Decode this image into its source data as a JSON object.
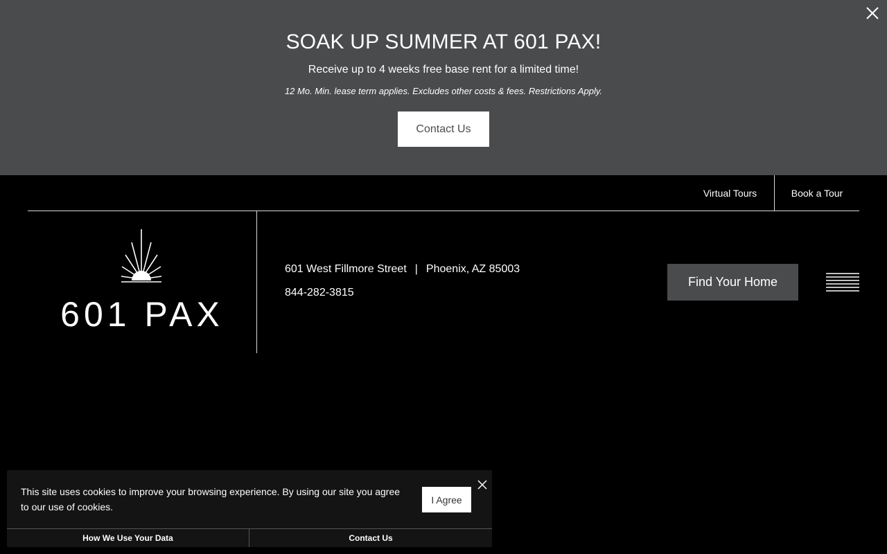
{
  "promo": {
    "title": "SOAK UP SUMMER AT 601 PAX!",
    "subtitle": "Receive up to 4 weeks free base rent for a limited time!",
    "fine_print": "12 Mo. Min. lease term applies. Excludes other costs & fees. Restrictions Apply.",
    "button_label": "Contact Us",
    "close_icon": "close-icon"
  },
  "topnav": {
    "virtual_tours": "Virtual Tours",
    "book_tour": "Book a Tour"
  },
  "header": {
    "logo_text": "601 PAX",
    "street": "601 West Fillmore Street",
    "separator": "|",
    "city": "Phoenix, AZ 85003",
    "phone": "844-282-3815",
    "find_button": "Find Your Home",
    "menu_icon": "hamburger-menu-icon"
  },
  "cookie": {
    "message": "This site uses cookies to improve your browsing experience. By using our site you agree to our use of cookies.",
    "agree_label": "I Agree",
    "link_data": "How We Use Your Data",
    "link_contact": "Contact Us"
  },
  "colors": {
    "page_bg": "#000000",
    "promo_bg": "#4a4b4d",
    "button_gray": "#4a4b4d",
    "cookie_bg": "#141414",
    "text": "#ffffff"
  }
}
